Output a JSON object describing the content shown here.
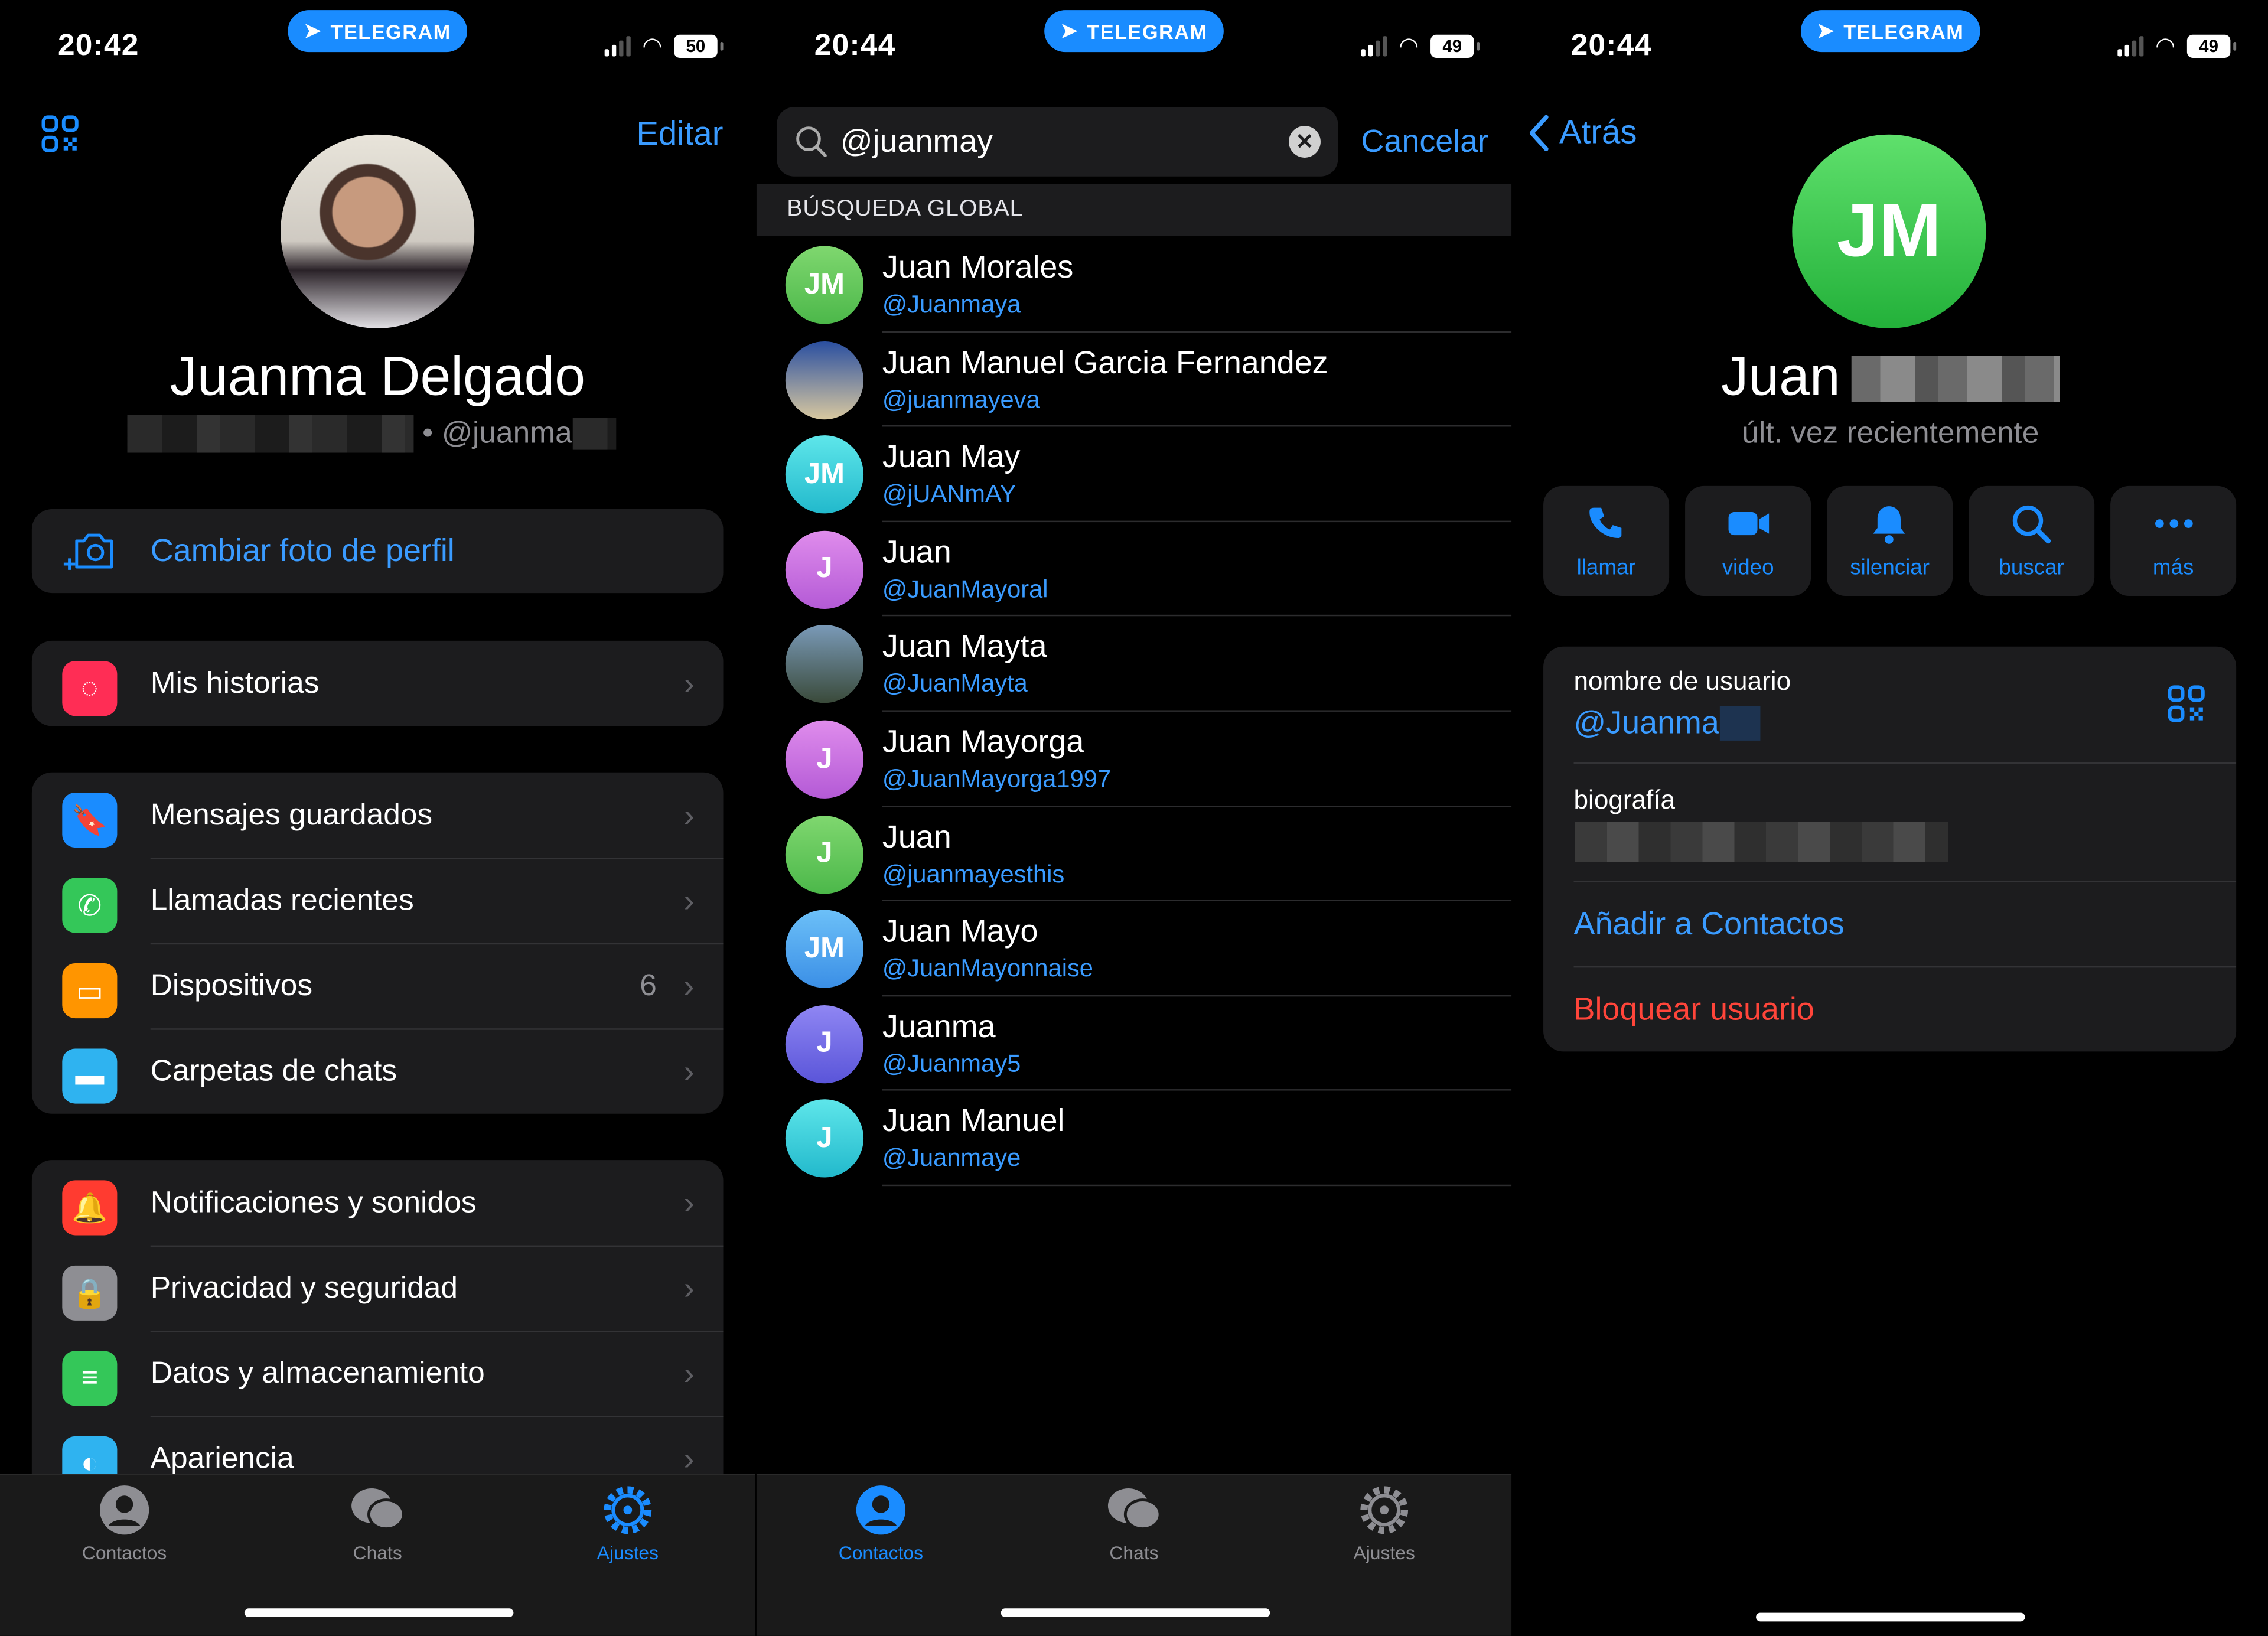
{
  "colors": {
    "accent": "#1a8cff",
    "danger": "#ff453a",
    "background": "#000000",
    "surface": "#1c1c1e"
  },
  "banner": "TELEGRAM",
  "settings": {
    "status": {
      "time": "20:42",
      "battery": "50"
    },
    "edit_label": "Editar",
    "profile_name": "Juanma Delgado",
    "username": "@juanma",
    "change_photo": "Cambiar foto de perfil",
    "groups": [
      [
        {
          "label": "Mis historias",
          "icon": "stories-icon",
          "color": "#ff2d55"
        }
      ],
      [
        {
          "label": "Mensajes guardados",
          "icon": "bookmark-icon",
          "color": "#1a8cff"
        },
        {
          "label": "Llamadas recientes",
          "icon": "phone-icon",
          "color": "#34c759"
        },
        {
          "label": "Dispositivos",
          "icon": "devices-icon",
          "color": "#ff9500",
          "value": "6"
        },
        {
          "label": "Carpetas de chats",
          "icon": "folder-icon",
          "color": "#2fb3f0"
        }
      ],
      [
        {
          "label": "Notificaciones y sonidos",
          "icon": "bell-icon",
          "color": "#ff3b30"
        },
        {
          "label": "Privacidad y seguridad",
          "icon": "lock-icon",
          "color": "#8e8e93"
        },
        {
          "label": "Datos y almacenamiento",
          "icon": "database-icon",
          "color": "#34c759"
        },
        {
          "label": "Apariencia",
          "icon": "appearance-icon",
          "color": "#2fb3f0"
        }
      ]
    ],
    "tabs": [
      {
        "label": "Contactos"
      },
      {
        "label": "Chats"
      },
      {
        "label": "Ajustes",
        "active": true
      }
    ]
  },
  "search": {
    "status": {
      "time": "20:44",
      "battery": "49"
    },
    "query": "@juanmay",
    "cancel_label": "Cancelar",
    "section_header": "BÚSQUEDA GLOBAL",
    "results": [
      {
        "name": "Juan Morales",
        "username": "@Juanmaya",
        "initials": "JM",
        "color": "green"
      },
      {
        "name": "Juan Manuel Garcia Fernandez",
        "username": "@juanmayeva",
        "initials": "",
        "color": "photo-blue"
      },
      {
        "name": "Juan May",
        "username": "@jUANmAY",
        "initials": "JM",
        "color": "cyan"
      },
      {
        "name": "Juan",
        "username": "@JuanMayoral",
        "initials": "J",
        "color": "purple"
      },
      {
        "name": "Juan Mayta",
        "username": "@JuanMayta",
        "initials": "",
        "color": "photo-landscape"
      },
      {
        "name": "Juan Mayorga",
        "username": "@JuanMayorga1997",
        "initials": "J",
        "color": "purple"
      },
      {
        "name": "Juan",
        "username": "@juanmayesthis",
        "initials": "J",
        "color": "green"
      },
      {
        "name": "Juan Mayo",
        "username": "@JuanMayonnaise",
        "initials": "JM",
        "color": "blue"
      },
      {
        "name": "Juanma",
        "username": "@Juanmay5",
        "initials": "J",
        "color": "violet"
      },
      {
        "name": "Juan Manuel",
        "username": "@Juanmaye",
        "initials": "J",
        "color": "cyan"
      }
    ],
    "tabs": [
      {
        "label": "Contactos",
        "active": true
      },
      {
        "label": "Chats"
      },
      {
        "label": "Ajustes"
      }
    ]
  },
  "contact": {
    "status": {
      "time": "20:44",
      "battery": "49"
    },
    "back_label": "Atrás",
    "initials": "JM",
    "name": "Juan",
    "last_seen": "últ. vez recientemente",
    "actions": [
      {
        "label": "llamar",
        "icon": "phone-icon"
      },
      {
        "label": "video",
        "icon": "video-icon"
      },
      {
        "label": "silenciar",
        "icon": "bell-icon"
      },
      {
        "label": "buscar",
        "icon": "search-icon"
      },
      {
        "label": "más",
        "icon": "more-icon"
      }
    ],
    "username_label": "nombre de usuario",
    "username": "@Juanma",
    "bio_label": "biografía",
    "add_contact": "Añadir a Contactos",
    "block_user": "Bloquear usuario"
  }
}
